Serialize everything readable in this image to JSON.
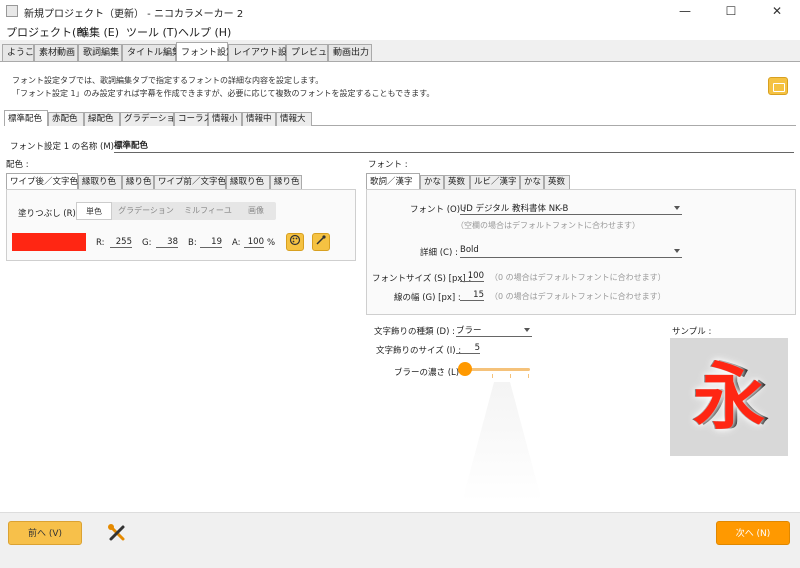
{
  "window": {
    "title": "新規プロジェクト（更新） - ニコカラメーカー 2",
    "minimize": "—",
    "maximize": "☐",
    "close": "✕"
  },
  "menu": [
    "プロジェクト(P)",
    "編集 (E)",
    "ツール (T)",
    "ヘルプ (H)"
  ],
  "main_tabs": [
    "ようこそ",
    "素材動画",
    "歌詞編集",
    "タイトル編集",
    "フォント設定",
    "レイアウト設定",
    "プレビュー",
    "動画出力"
  ],
  "description": {
    "line1": "フォント設定タブでは、歌詞編集タブで指定するフォントの詳細な内容を設定します。",
    "line2": "「フォント設定 1」のみ設定すれば字幕を作成できますが、必要に応じて複数のフォントを設定することもできます。"
  },
  "font_tabs": [
    "標準配色",
    "赤配色",
    "緑配色",
    "グラデーション",
    "コーラス",
    "情報小",
    "情報中",
    "情報大"
  ],
  "font_name": {
    "label": "フォント設定 1 の名称 (M) :",
    "value": "標準配色"
  },
  "color_section": {
    "label": "配色 :",
    "tabs": [
      "ワイプ後／文字色",
      "縁取り色",
      "縁り色",
      "ワイプ前／文字色",
      "縁取り色",
      "縁り色"
    ],
    "fill_label": "塗りつぶし (R) :",
    "fill_modes": [
      "単色",
      "グラデーション",
      "ミルフィーユ",
      "画像"
    ],
    "swatch_color": "#ff2613",
    "r_label": "R:",
    "r": "255",
    "g_label": "G:",
    "g": "38",
    "b_label": "B:",
    "b": "19",
    "a_label": "A:",
    "a": "100",
    "a_unit": "%"
  },
  "font_section": {
    "label": "フォント :",
    "tabs": [
      "歌詞／漢字",
      "かな",
      "英数",
      "ルビ／漢字",
      "かな",
      "英数"
    ],
    "font_label": "フォント (O) :",
    "font_value": "UD デジタル 教科書体 NK-B",
    "font_hint": "（空欄の場合はデフォルトフォントに合わせます）",
    "detail_label": "詳細 (C) :",
    "detail_value": "Bold",
    "size_label": "フォントサイズ (S) [px] :",
    "size_value": "100",
    "size_hint": "（0 の場合はデフォルトフォントに合わせます）",
    "line_label": "線の幅 (G) [px] :",
    "line_value": "15",
    "line_hint": "（0 の場合はデフォルトフォントに合わせます）"
  },
  "decoration": {
    "type_label": "文字飾りの種類 (D) :",
    "type_value": "ブラー",
    "size_label": "文字飾りのサイズ (I) :",
    "size_value": "5",
    "blur_label": "ブラーの濃さ (L) :",
    "blur_level": 0
  },
  "sample": {
    "label": "サンプル :",
    "char": "永"
  },
  "footer": {
    "prev": "前へ (V)",
    "next": "次へ (N)"
  },
  "colors": {
    "accent": "#f5c242",
    "next_btn": "#ff9900"
  }
}
